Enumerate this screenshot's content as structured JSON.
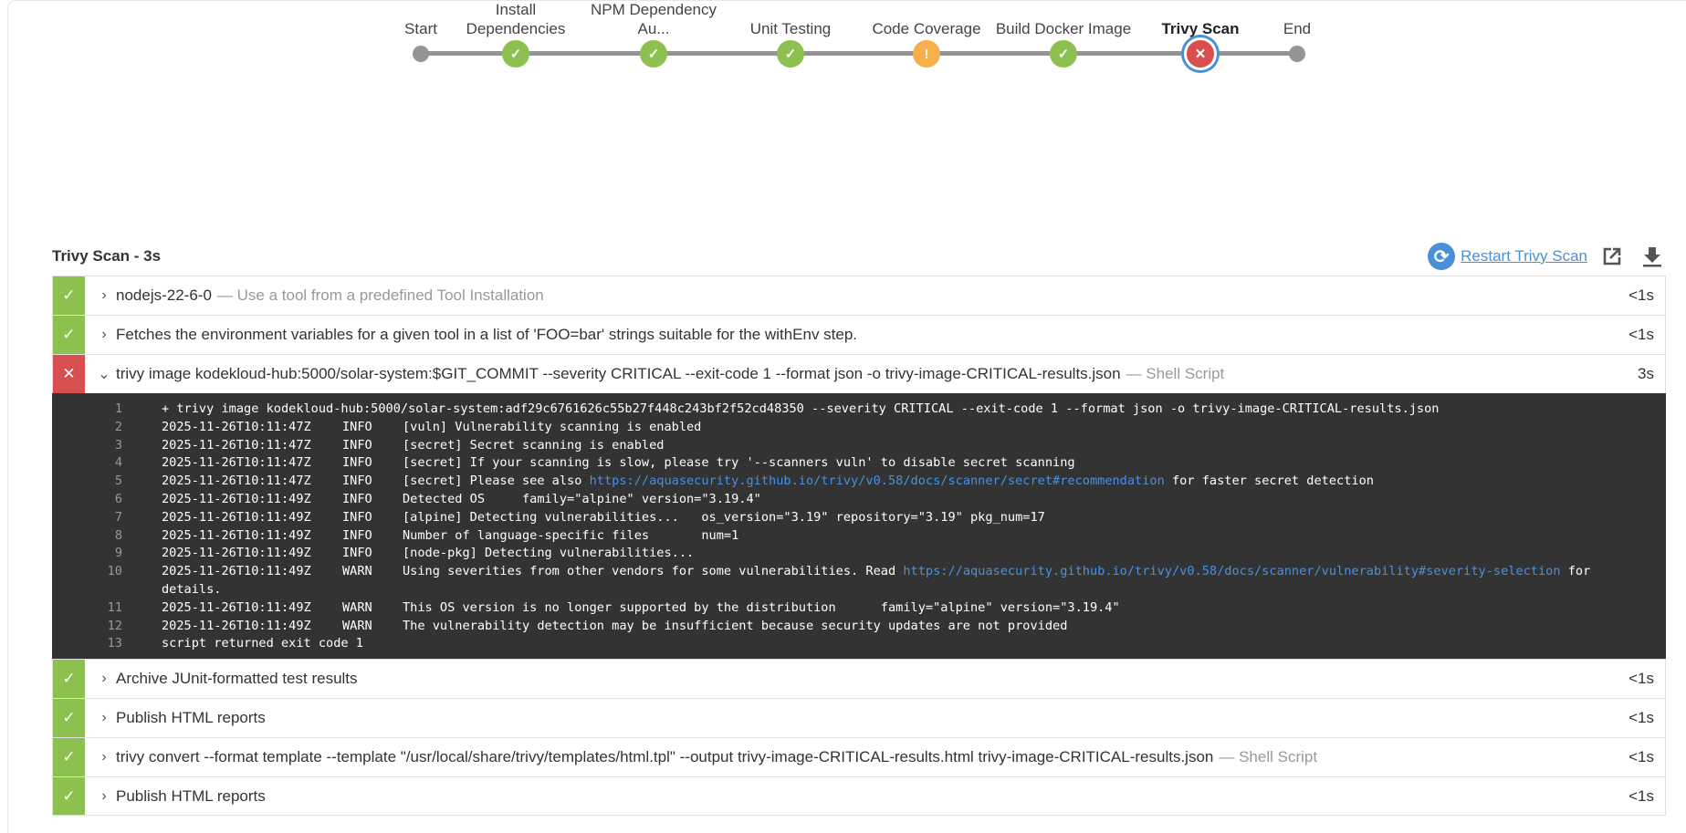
{
  "pipeline": {
    "stages": [
      {
        "label": "Start",
        "status": "start"
      },
      {
        "label": "Install Dependencies",
        "status": "success"
      },
      {
        "label": "NPM Dependency Au...",
        "status": "success"
      },
      {
        "label": "Unit Testing",
        "status": "success"
      },
      {
        "label": "Code Coverage",
        "status": "unstable"
      },
      {
        "label": "Build Docker Image",
        "status": "success"
      },
      {
        "label": "Trivy Scan",
        "status": "failed",
        "selected": true
      },
      {
        "label": "End",
        "status": "end"
      }
    ]
  },
  "stage_detail": {
    "title": "Trivy Scan - 3s",
    "restart_label": "Restart Trivy Scan"
  },
  "steps": [
    {
      "status": "success",
      "text": "nodejs-22-6-0",
      "desc": "— Use a tool from a predefined Tool Installation",
      "duration": "<1s"
    },
    {
      "status": "success",
      "text": "Fetches the environment variables for a given tool in a list of 'FOO=bar' strings suitable for the withEnv step.",
      "desc": "",
      "duration": "<1s"
    },
    {
      "status": "failed",
      "expanded": true,
      "text": "trivy image kodekloud-hub:5000/solar-system:$GIT_COMMIT --severity CRITICAL --exit-code 1 --format json -o trivy-image-CRITICAL-results.json",
      "desc": "— Shell Script",
      "duration": "3s"
    },
    {
      "status": "success",
      "text": "Archive JUnit-formatted test results",
      "desc": "",
      "duration": "<1s"
    },
    {
      "status": "success",
      "text": "Publish HTML reports",
      "desc": "",
      "duration": "<1s"
    },
    {
      "status": "success",
      "text": "trivy convert --format template --template \"/usr/local/share/trivy/templates/html.tpl\" --output trivy-image-CRITICAL-results.html trivy-image-CRITICAL-results.json",
      "desc": "— Shell Script",
      "duration": "<1s"
    },
    {
      "status": "success",
      "text": "Publish HTML reports",
      "desc": "",
      "duration": "<1s"
    }
  ],
  "log": [
    {
      "num": "1",
      "time": "",
      "level": "",
      "text": "+ trivy image kodekloud-hub:5000/solar-system:adf29c6761626c55b27f448c243bf2f52cd48350 --severity CRITICAL --exit-code 1 --format json -o trivy-image-CRITICAL-results.json",
      "link": "",
      "after": ""
    },
    {
      "num": "2",
      "time": "2025-11-26T10:11:47Z",
      "level": "INFO",
      "text": "[vuln] Vulnerability scanning is enabled",
      "link": "",
      "after": ""
    },
    {
      "num": "3",
      "time": "2025-11-26T10:11:47Z",
      "level": "INFO",
      "text": "[secret] Secret scanning is enabled",
      "link": "",
      "after": ""
    },
    {
      "num": "4",
      "time": "2025-11-26T10:11:47Z",
      "level": "INFO",
      "text": "[secret] If your scanning is slow, please try '--scanners vuln' to disable secret scanning",
      "link": "",
      "after": ""
    },
    {
      "num": "5",
      "time": "2025-11-26T10:11:47Z",
      "level": "INFO",
      "text": "[secret] Please see also ",
      "link": "https://aquasecurity.github.io/trivy/v0.58/docs/scanner/secret#recommendation",
      "after": " for faster secret detection"
    },
    {
      "num": "6",
      "time": "2025-11-26T10:11:49Z",
      "level": "INFO",
      "text": "Detected OS     family=\"alpine\" version=\"3.19.4\"",
      "link": "",
      "after": ""
    },
    {
      "num": "7",
      "time": "2025-11-26T10:11:49Z",
      "level": "INFO",
      "text": "[alpine] Detecting vulnerabilities...   os_version=\"3.19\" repository=\"3.19\" pkg_num=17",
      "link": "",
      "after": ""
    },
    {
      "num": "8",
      "time": "2025-11-26T10:11:49Z",
      "level": "INFO",
      "text": "Number of language-specific files       num=1",
      "link": "",
      "after": ""
    },
    {
      "num": "9",
      "time": "2025-11-26T10:11:49Z",
      "level": "INFO",
      "text": "[node-pkg] Detecting vulnerabilities...",
      "link": "",
      "after": ""
    },
    {
      "num": "10",
      "time": "2025-11-26T10:11:49Z",
      "level": "WARN",
      "text": "Using severities from other vendors for some vulnerabilities. Read ",
      "link": "https://aquasecurity.github.io/trivy/v0.58/docs/scanner/vulnerability#severity-selection",
      "after": " for details."
    },
    {
      "num": "11",
      "time": "2025-11-26T10:11:49Z",
      "level": "WARN",
      "text": "This OS version is no longer supported by the distribution      family=\"alpine\" version=\"3.19.4\"",
      "link": "",
      "after": ""
    },
    {
      "num": "12",
      "time": "2025-11-26T10:11:49Z",
      "level": "WARN",
      "text": "The vulnerability detection may be insufficient because security updates are not provided",
      "link": "",
      "after": ""
    },
    {
      "num": "13",
      "time": "",
      "level": "",
      "text": "script returned exit code 1",
      "link": "",
      "after": ""
    }
  ],
  "colors": {
    "success": "#8cc04f",
    "failed": "#d94f4f",
    "unstable": "#f6b04b",
    "selected_ring": "#4a90d9",
    "log_bg": "#333333",
    "link": "#4a90e2"
  },
  "icons": {
    "success": "check-icon",
    "failed": "x-icon",
    "unstable": "exclamation-icon",
    "restart": "refresh-icon",
    "open": "external-link-icon",
    "download": "download-icon"
  }
}
